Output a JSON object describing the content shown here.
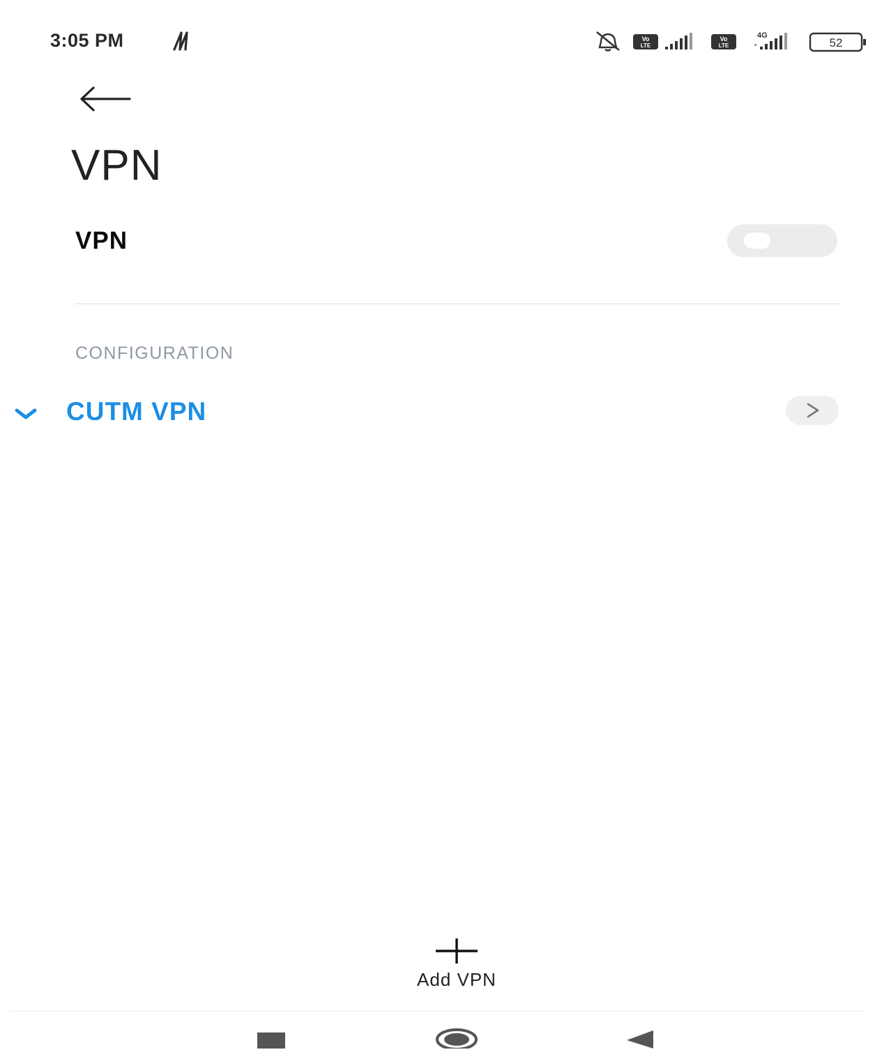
{
  "status_bar": {
    "time": "3:05 PM",
    "battery_level": "52",
    "network_type": "4G",
    "icons": [
      "nfc-icon",
      "mute-icon",
      "volte-icon",
      "signal-icon",
      "volte-icon",
      "signal-icon",
      "battery-icon"
    ]
  },
  "header": {
    "back_icon": "back-arrow-icon",
    "title": "VPN"
  },
  "vpn_toggle": {
    "label": "VPN",
    "enabled": false
  },
  "configuration": {
    "section_title": "CONFIGURATION",
    "items": [
      {
        "name": "CUTM VPN",
        "selected": true,
        "detail_icon": "chevron-right-icon"
      }
    ]
  },
  "add_vpn": {
    "label": "Add VPN",
    "icon": "plus-icon"
  },
  "nav_bar": {
    "buttons": [
      "recents-icon",
      "home-icon",
      "back-icon"
    ]
  },
  "colors": {
    "accent": "#1d8ee4",
    "section_header": "#8f98a4",
    "toggle_off": "#ececec"
  }
}
